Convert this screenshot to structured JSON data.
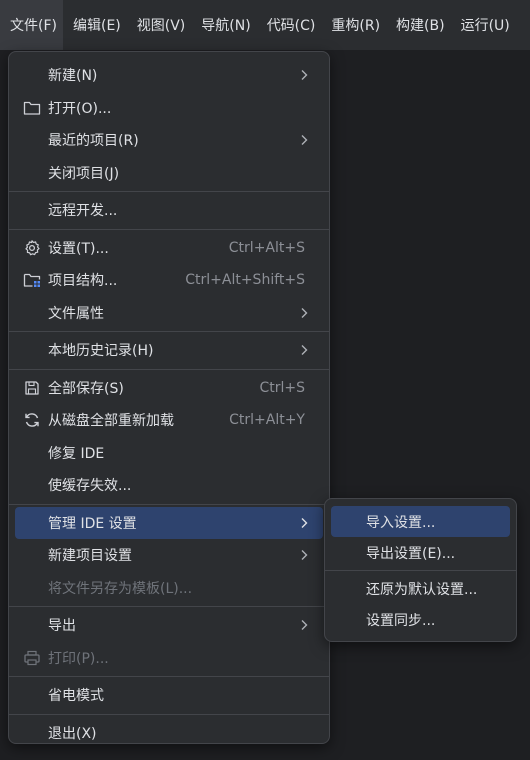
{
  "menubar": {
    "items": [
      {
        "label": "文件(F)",
        "active": true
      },
      {
        "label": "编辑(E)"
      },
      {
        "label": "视图(V)"
      },
      {
        "label": "导航(N)"
      },
      {
        "label": "代码(C)"
      },
      {
        "label": "重构(R)"
      },
      {
        "label": "构建(B)"
      },
      {
        "label": "运行(U)"
      }
    ]
  },
  "file_menu": {
    "new": {
      "label": "新建(N)"
    },
    "open": {
      "label": "打开(O)...",
      "icon": "folder-icon"
    },
    "recent": {
      "label": "最近的项目(R)"
    },
    "close": {
      "label": "关闭项目(J)"
    },
    "remote": {
      "label": "远程开发..."
    },
    "settings": {
      "label": "设置(T)...",
      "shortcut": "Ctrl+Alt+S",
      "icon": "gear-icon"
    },
    "project_structure": {
      "label": "项目结构...",
      "shortcut": "Ctrl+Alt+Shift+S",
      "icon": "project-structure-icon"
    },
    "file_properties": {
      "label": "文件属性"
    },
    "local_history": {
      "label": "本地历史记录(H)"
    },
    "save_all": {
      "label": "全部保存(S)",
      "shortcut": "Ctrl+S",
      "icon": "save-icon"
    },
    "reload": {
      "label": "从磁盘全部重新加载",
      "shortcut": "Ctrl+Alt+Y",
      "icon": "reload-icon"
    },
    "repair": {
      "label": "修复 IDE"
    },
    "invalidate": {
      "label": "使缓存失效..."
    },
    "manage_ide": {
      "label": "管理 IDE 设置"
    },
    "new_project_settings": {
      "label": "新建项目设置"
    },
    "save_as_template": {
      "label": "将文件另存为模板(L)..."
    },
    "export": {
      "label": "导出"
    },
    "print": {
      "label": "打印(P)...",
      "icon": "printer-icon"
    },
    "power_save": {
      "label": "省电模式"
    },
    "exit": {
      "label": "退出(X)"
    }
  },
  "sub_menu": {
    "import": {
      "label": "导入设置..."
    },
    "export": {
      "label": "导出设置(E)..."
    },
    "restore": {
      "label": "还原为默认设置..."
    },
    "sync": {
      "label": "设置同步..."
    }
  },
  "colors": {
    "background": "#1e1f22",
    "menu_bg": "#2b2d30",
    "selected": "#2e436e",
    "text": "#dfe1e5",
    "disabled": "#6f737a"
  }
}
